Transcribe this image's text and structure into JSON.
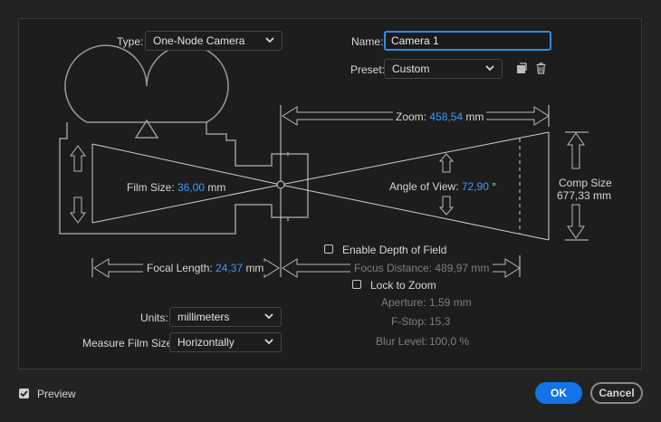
{
  "type": {
    "label": "Type:",
    "value": "One-Node Camera"
  },
  "name": {
    "label": "Name:",
    "value": "Camera 1"
  },
  "preset": {
    "label": "Preset:",
    "value": "Custom"
  },
  "zoom": {
    "label": "Zoom:",
    "value": "458,54",
    "unit": "mm"
  },
  "film_size": {
    "label": "Film Size:",
    "value": "36,00",
    "unit": "mm"
  },
  "angle_of_view": {
    "label": "Angle of View:",
    "value": "72,90",
    "unit": "°"
  },
  "comp_size": {
    "label": "Comp Size",
    "value": "677,33 mm"
  },
  "focal_length": {
    "label": "Focal Length:",
    "value": "24,37",
    "unit": "mm"
  },
  "depth_of_field": {
    "label": "Enable Depth of Field",
    "checked": false
  },
  "focus_distance": {
    "label": "Focus Distance:",
    "value": "489,97 mm"
  },
  "lock_to_zoom": {
    "label": "Lock to Zoom",
    "checked": false
  },
  "aperture": {
    "label": "Aperture:",
    "value": "1,59 mm"
  },
  "fstop": {
    "label": "F-Stop:",
    "value": "15,3"
  },
  "blur_level": {
    "label": "Blur Level:",
    "value": "100,0 %"
  },
  "units": {
    "label": "Units:",
    "value": "millimeters"
  },
  "measure_film_size": {
    "label": "Measure Film Size:",
    "value": "Horizontally"
  },
  "preview": {
    "label": "Preview",
    "checked": true
  },
  "buttons": {
    "ok": "OK",
    "cancel": "Cancel"
  },
  "icons": [
    "save-preset-icon",
    "trash-icon",
    "chevron-down-icon",
    "checkmark-icon"
  ],
  "colors": {
    "accent": "#1473e6",
    "value_blue": "#3d9bff",
    "input_focus": "#2d8ceb"
  }
}
